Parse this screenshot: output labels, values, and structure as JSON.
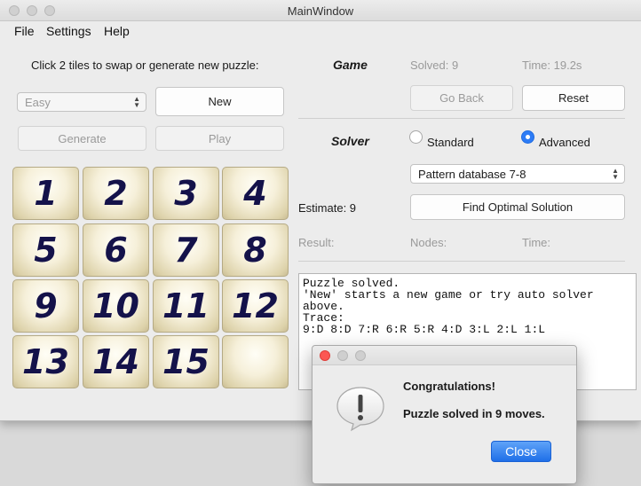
{
  "window": {
    "title": "MainWindow"
  },
  "menu": [
    "File",
    "Settings",
    "Help"
  ],
  "left": {
    "instruction": "Click 2 tiles to swap or generate new puzzle:",
    "difficulty": "Easy",
    "new_button": "New",
    "generate_button": "Generate",
    "play_button": "Play"
  },
  "board": {
    "tiles": [
      "1",
      "2",
      "3",
      "4",
      "5",
      "6",
      "7",
      "8",
      "9",
      "10",
      "11",
      "12",
      "13",
      "14",
      "15",
      ""
    ]
  },
  "game": {
    "heading": "Game",
    "solved": "Solved: 9",
    "time": "Time: 19.2s",
    "go_back_button": "Go Back",
    "reset_button": "Reset"
  },
  "solver": {
    "heading": "Solver",
    "standard_label": "Standard",
    "advanced_label": "Advanced",
    "selected": "Advanced",
    "method": "Pattern database 7-8",
    "estimate": "Estimate: 9",
    "find_button": "Find Optimal Solution",
    "result_label": "Result:",
    "nodes_label": "Nodes:",
    "time_label": "Time:"
  },
  "log": {
    "text": "Puzzle solved.\n'New' starts a new game or try auto solver\nabove.\nTrace:\n9:D 8:D 7:R 6:R 5:R 4:D 3:L 2:L 1:L"
  },
  "dialog": {
    "heading": "Congratulations!",
    "message": "Puzzle solved in 9 moves.",
    "close_button": "Close"
  },
  "colors": {
    "accent": "#2d7cf6",
    "tile_text": "#14124a",
    "close_red": "#fc5753"
  }
}
